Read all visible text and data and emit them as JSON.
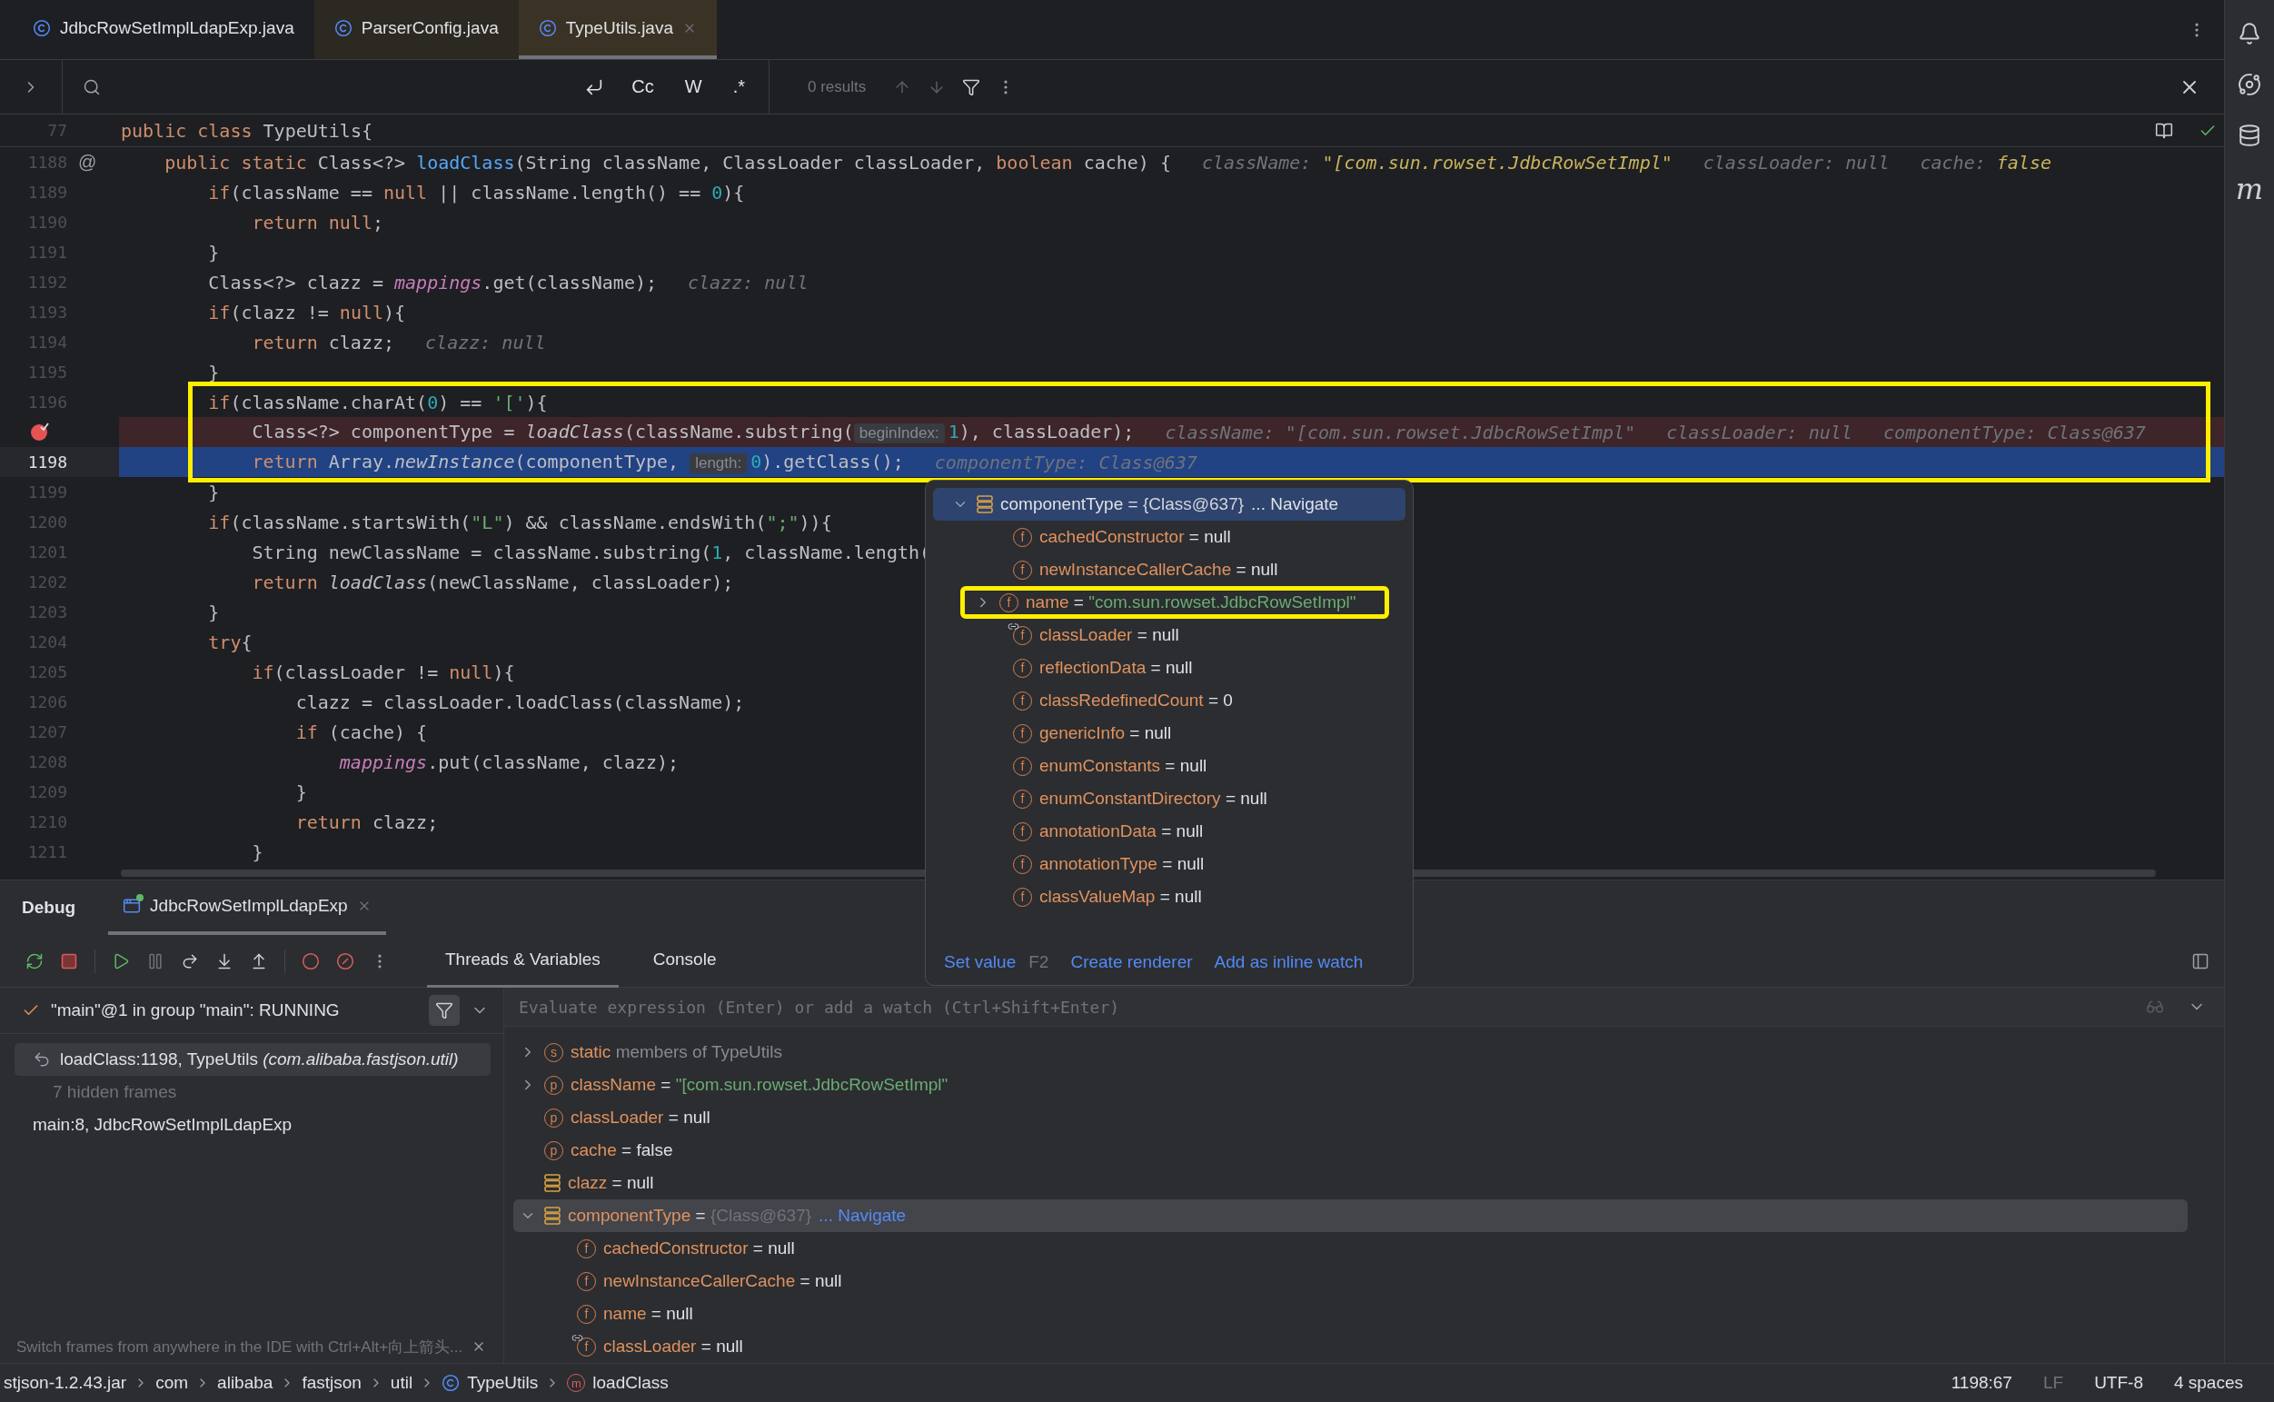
{
  "editor_tabs": [
    {
      "label": "JdbcRowSetImplLdapExp.java",
      "library": false,
      "selected": false
    },
    {
      "label": "ParserConfig.java",
      "library": true,
      "selected": false
    },
    {
      "label": "TypeUtils.java",
      "library": true,
      "selected": true
    }
  ],
  "find_bar": {
    "options": [
      "Cc",
      "W",
      ".*"
    ],
    "results": "0 results"
  },
  "sticky_line": {
    "number": "77",
    "tokens": [
      {
        "kind": "keyword",
        "text": "public class "
      },
      {
        "kind": "plain",
        "text": "TypeUtils{"
      }
    ]
  },
  "code_lines": [
    {
      "number": "1188",
      "gutter_mark": "@",
      "kind": "normal",
      "tokens": [
        {
          "kind": "keyword",
          "text": "    public static "
        },
        {
          "kind": "plain",
          "text": "Class<?> "
        },
        {
          "kind": "declaration",
          "text": "loadClass"
        },
        {
          "kind": "plain",
          "text": "(String className, ClassLoader classLoader, "
        },
        {
          "kind": "keyword",
          "text": "boolean"
        },
        {
          "kind": "plain",
          "text": " cache) {"
        }
      ],
      "inline_values": [
        {
          "name": "className:",
          "value": "\"[com.sun.rowset.JdbcRowSetImpl\"",
          "kind": "string"
        },
        {
          "name": "classLoader:",
          "value": "null",
          "kind": "plain"
        },
        {
          "name": "cache:",
          "value": "false",
          "kind": "string"
        }
      ]
    },
    {
      "number": "1189",
      "kind": "normal",
      "tokens": [
        {
          "kind": "keyword",
          "text": "        if"
        },
        {
          "kind": "plain",
          "text": "(className == "
        },
        {
          "kind": "keyword",
          "text": "null"
        },
        {
          "kind": "plain",
          "text": " || className.length() == "
        },
        {
          "kind": "number",
          "text": "0"
        },
        {
          "kind": "plain",
          "text": "){"
        }
      ]
    },
    {
      "number": "1190",
      "kind": "normal",
      "tokens": [
        {
          "kind": "keyword",
          "text": "            return null"
        },
        {
          "kind": "plain",
          "text": ";"
        }
      ]
    },
    {
      "number": "1191",
      "kind": "normal",
      "tokens": [
        {
          "kind": "plain",
          "text": "        }"
        }
      ]
    },
    {
      "number": "1192",
      "kind": "normal",
      "tokens": [
        {
          "kind": "plain",
          "text": "        Class<?> clazz = "
        },
        {
          "kind": "field",
          "text": "mappings"
        },
        {
          "kind": "plain",
          "text": ".get(className);"
        }
      ],
      "inline_values": [
        {
          "name": "clazz:",
          "value": "null",
          "kind": "plain"
        }
      ]
    },
    {
      "number": "1193",
      "kind": "normal",
      "tokens": [
        {
          "kind": "keyword",
          "text": "        if"
        },
        {
          "kind": "plain",
          "text": "(clazz != "
        },
        {
          "kind": "keyword",
          "text": "null"
        },
        {
          "kind": "plain",
          "text": "){"
        }
      ]
    },
    {
      "number": "1194",
      "kind": "normal",
      "tokens": [
        {
          "kind": "keyword",
          "text": "            return"
        },
        {
          "kind": "plain",
          "text": " clazz;"
        }
      ],
      "inline_values": [
        {
          "name": "clazz:",
          "value": "null",
          "kind": "plain"
        }
      ]
    },
    {
      "number": "1195",
      "kind": "normal",
      "tokens": [
        {
          "kind": "plain",
          "text": "        }"
        }
      ]
    },
    {
      "number": "1196",
      "kind": "normal",
      "tokens": [
        {
          "kind": "keyword",
          "text": "        if"
        },
        {
          "kind": "plain",
          "text": "(className.charAt("
        },
        {
          "kind": "number",
          "text": "0"
        },
        {
          "kind": "plain",
          "text": ") == "
        },
        {
          "kind": "string",
          "text": "'['"
        },
        {
          "kind": "plain",
          "text": "){"
        }
      ]
    },
    {
      "kind": "breakpoint",
      "tokens": [
        {
          "kind": "plain",
          "text": "            Class<?> componentType = "
        },
        {
          "kind": "call",
          "text": "loadClass"
        },
        {
          "kind": "plain",
          "text": "(className.substring("
        },
        {
          "kind": "hint",
          "text": "beginIndex:"
        },
        {
          "kind": "number",
          "text": "1"
        },
        {
          "kind": "plain",
          "text": "), classLoader);"
        }
      ],
      "inline_values": [
        {
          "name": "className:",
          "value": "\"[com.sun.rowset.JdbcRowSetImpl\"",
          "kind": "plain"
        },
        {
          "name": "classLoader:",
          "value": "null",
          "kind": "plain"
        },
        {
          "name": "componentType:",
          "value": "Class@637",
          "kind": "plain"
        }
      ]
    },
    {
      "number": "1198",
      "kind": "current",
      "tokens": [
        {
          "kind": "keyword",
          "text": "            return"
        },
        {
          "kind": "plain",
          "text": " Array."
        },
        {
          "kind": "call",
          "text": "newInstance"
        },
        {
          "kind": "plain",
          "text": "(componentType, "
        },
        {
          "kind": "hint",
          "text": "length:"
        },
        {
          "kind": "number",
          "text": "0"
        },
        {
          "kind": "plain",
          "text": ").getClass();"
        }
      ],
      "inline_values": [
        {
          "name": "componentType:",
          "value": "Class@637",
          "kind": "plain"
        }
      ]
    },
    {
      "number": "1199",
      "kind": "normal",
      "tokens": [
        {
          "kind": "plain",
          "text": "        }"
        }
      ]
    },
    {
      "number": "1200",
      "kind": "normal",
      "tokens": [
        {
          "kind": "keyword",
          "text": "        if"
        },
        {
          "kind": "plain",
          "text": "(className.startsWith("
        },
        {
          "kind": "string",
          "text": "\"L\""
        },
        {
          "kind": "plain",
          "text": ") && className.endsWith("
        },
        {
          "kind": "string",
          "text": "\";\""
        },
        {
          "kind": "plain",
          "text": ")){"
        }
      ]
    },
    {
      "number": "1201",
      "kind": "normal",
      "tokens": [
        {
          "kind": "plain",
          "text": "            String newClassName = className.substring("
        },
        {
          "kind": "number",
          "text": "1"
        },
        {
          "kind": "plain",
          "text": ", className.length("
        }
      ]
    },
    {
      "number": "1202",
      "kind": "normal",
      "tokens": [
        {
          "kind": "keyword",
          "text": "            return "
        },
        {
          "kind": "call",
          "text": "loadClass"
        },
        {
          "kind": "plain",
          "text": "(newClassName, classLoader);"
        }
      ]
    },
    {
      "number": "1203",
      "kind": "normal",
      "tokens": [
        {
          "kind": "plain",
          "text": "        }"
        }
      ]
    },
    {
      "number": "1204",
      "kind": "normal",
      "tokens": [
        {
          "kind": "keyword",
          "text": "        try"
        },
        {
          "kind": "plain",
          "text": "{"
        }
      ]
    },
    {
      "number": "1205",
      "kind": "normal",
      "tokens": [
        {
          "kind": "keyword",
          "text": "            if"
        },
        {
          "kind": "plain",
          "text": "(classLoader != "
        },
        {
          "kind": "keyword",
          "text": "null"
        },
        {
          "kind": "plain",
          "text": "){"
        }
      ]
    },
    {
      "number": "1206",
      "kind": "normal",
      "tokens": [
        {
          "kind": "plain",
          "text": "                clazz = classLoader.loadClass(className);"
        }
      ]
    },
    {
      "number": "1207",
      "kind": "normal",
      "tokens": [
        {
          "kind": "keyword",
          "text": "                if"
        },
        {
          "kind": "plain",
          "text": " (cache) {"
        }
      ]
    },
    {
      "number": "1208",
      "kind": "normal",
      "tokens": [
        {
          "kind": "field",
          "text": "                    mappings"
        },
        {
          "kind": "plain",
          "text": ".put(className, clazz);"
        }
      ]
    },
    {
      "number": "1209",
      "kind": "normal",
      "tokens": [
        {
          "kind": "plain",
          "text": "                }"
        }
      ]
    },
    {
      "number": "1210",
      "kind": "normal",
      "tokens": [
        {
          "kind": "keyword",
          "text": "                return"
        },
        {
          "kind": "plain",
          "text": " clazz;"
        }
      ]
    },
    {
      "number": "1211",
      "kind": "normal",
      "tokens": [
        {
          "kind": "plain",
          "text": "            }"
        }
      ]
    }
  ],
  "value_popup": {
    "root": {
      "kind": "local",
      "name": "componentType",
      "op": "=",
      "value": {
        "kind": "ref",
        "text": "{Class@637}"
      },
      "link": "... Navigate",
      "expanded": true,
      "selected": true,
      "highlighted": false,
      "overlay": false
    },
    "fields": [
      {
        "kind": "member",
        "badge": "f",
        "name": "cachedConstructor",
        "op": "=",
        "value": {
          "kind": "plain",
          "text": "null"
        },
        "selected": false,
        "highlighted": false,
        "overlay": false
      },
      {
        "kind": "member",
        "badge": "f",
        "name": "newInstanceCallerCache",
        "op": "=",
        "value": {
          "kind": "plain",
          "text": "null"
        },
        "selected": false,
        "highlighted": false,
        "overlay": false
      },
      {
        "kind": "member",
        "badge": "f",
        "name": "name",
        "op": "=",
        "value": {
          "kind": "string",
          "text": "\"com.sun.rowset.JdbcRowSetImpl\""
        },
        "expanded": false,
        "selected": false,
        "highlighted": true,
        "overlay": false
      },
      {
        "kind": "member",
        "badge": "f",
        "name": "classLoader",
        "op": "=",
        "value": {
          "kind": "plain",
          "text": "null"
        },
        "selected": false,
        "highlighted": false,
        "overlay": true
      },
      {
        "kind": "member",
        "badge": "f",
        "name": "reflectionData",
        "op": "=",
        "value": {
          "kind": "plain",
          "text": "null"
        },
        "selected": false,
        "highlighted": false,
        "overlay": false
      },
      {
        "kind": "member",
        "badge": "f",
        "name": "classRedefinedCount",
        "op": "=",
        "value": {
          "kind": "plain",
          "text": "0"
        },
        "selected": false,
        "highlighted": false,
        "overlay": false
      },
      {
        "kind": "member",
        "badge": "f",
        "name": "genericInfo",
        "op": "=",
        "value": {
          "kind": "plain",
          "text": "null"
        },
        "selected": false,
        "highlighted": false,
        "overlay": false
      },
      {
        "kind": "member",
        "badge": "f",
        "name": "enumConstants",
        "op": "=",
        "value": {
          "kind": "plain",
          "text": "null"
        },
        "selected": false,
        "highlighted": false,
        "overlay": false
      },
      {
        "kind": "member",
        "badge": "f",
        "name": "enumConstantDirectory",
        "op": "=",
        "value": {
          "kind": "plain",
          "text": "null"
        },
        "selected": false,
        "highlighted": false,
        "overlay": false
      },
      {
        "kind": "member",
        "badge": "f",
        "name": "annotationData",
        "op": "=",
        "value": {
          "kind": "plain",
          "text": "null"
        },
        "selected": false,
        "highlighted": false,
        "overlay": false
      },
      {
        "kind": "member",
        "badge": "f",
        "name": "annotationType",
        "op": "=",
        "value": {
          "kind": "plain",
          "text": "null"
        },
        "selected": false,
        "highlighted": false,
        "overlay": false
      },
      {
        "kind": "member",
        "badge": "f",
        "name": "classValueMap",
        "op": "=",
        "value": {
          "kind": "plain",
          "text": "null"
        },
        "selected": false,
        "highlighted": false,
        "overlay": false
      }
    ],
    "actions": [
      {
        "label": "Set value",
        "shortcut": "F2"
      },
      {
        "label": "Create renderer"
      },
      {
        "label": "Add as inline watch"
      }
    ]
  },
  "debug_panel": {
    "title": "Debug",
    "session_tab": {
      "label": "JdbcRowSetImplLdapExp",
      "running": true
    },
    "view_tabs": [
      {
        "label": "Threads & Variables",
        "selected": true
      },
      {
        "label": "Console",
        "selected": false
      }
    ],
    "thread": {
      "label": "\"main\"@1 in group \"main\": RUNNING"
    },
    "frames": [
      {
        "kind": "frame",
        "text": "loadClass:1198, TypeUtils *(com.alibaba.fastjson.util)*",
        "selected": true
      },
      {
        "kind": "hidden",
        "text": "7 hidden frames",
        "selected": false
      },
      {
        "kind": "frame",
        "text": "main:8, JdbcRowSetImplLdapExp",
        "selected": false
      }
    ],
    "frames_hint": "Switch frames from anywhere in the IDE with Ctrl+Alt+向上箭头...",
    "evaluate": {
      "placeholder": "Evaluate expression (Enter) or add a watch (Ctrl+Shift+Enter)"
    },
    "variables": [
      {
        "kind": "member",
        "badge": "s",
        "name": "static",
        "value": {
          "kind": "note",
          "text": "members of TypeUtils"
        },
        "expanded": false,
        "selected": false,
        "overlay": false
      },
      {
        "kind": "member",
        "badge": "p",
        "name": "className",
        "op": "=",
        "value": {
          "kind": "string",
          "text": "\"[com.sun.rowset.JdbcRowSetImpl\""
        },
        "expanded": false,
        "selected": false,
        "overlay": false
      },
      {
        "kind": "member",
        "badge": "p",
        "name": "classLoader",
        "op": "=",
        "value": {
          "kind": "plain",
          "text": "null"
        },
        "selected": false,
        "overlay": false
      },
      {
        "kind": "member",
        "badge": "p",
        "name": "cache",
        "op": "=",
        "value": {
          "kind": "plain",
          "text": "false"
        },
        "selected": false,
        "overlay": false
      },
      {
        "kind": "local",
        "name": "clazz",
        "op": "=",
        "value": {
          "kind": "plain",
          "text": "null"
        },
        "selected": false,
        "overlay": false
      },
      {
        "kind": "local",
        "name": "componentType",
        "op": "=",
        "value": {
          "kind": "ref",
          "text": "{Class@637}"
        },
        "link": "... Navigate",
        "expanded": true,
        "selected": true,
        "overlay": false,
        "children": [
          {
            "kind": "member",
            "badge": "f",
            "name": "cachedConstructor",
            "op": "=",
            "value": {
              "kind": "plain",
              "text": "null"
            },
            "selected": false,
            "overlay": false
          },
          {
            "kind": "member",
            "badge": "f",
            "name": "newInstanceCallerCache",
            "op": "=",
            "value": {
              "kind": "plain",
              "text": "null"
            },
            "selected": false,
            "overlay": false
          },
          {
            "kind": "member",
            "badge": "f",
            "name": "name",
            "op": "=",
            "value": {
              "kind": "plain",
              "text": "null"
            },
            "selected": false,
            "overlay": false
          },
          {
            "kind": "member",
            "badge": "f",
            "name": "classLoader",
            "op": "=",
            "value": {
              "kind": "plain",
              "text": "null"
            },
            "selected": false,
            "overlay": true
          }
        ]
      }
    ]
  },
  "status_bar": {
    "breadcrumbs": [
      {
        "kind": "text",
        "label": "stjson-1.2.43.jar"
      },
      {
        "kind": "text",
        "label": "com"
      },
      {
        "kind": "text",
        "label": "alibaba"
      },
      {
        "kind": "text",
        "label": "fastjson"
      },
      {
        "kind": "text",
        "label": "util"
      },
      {
        "kind": "class",
        "label": "TypeUtils"
      },
      {
        "kind": "method",
        "badge": "m",
        "label": "loadClass"
      }
    ],
    "items": [
      "1198:67",
      "LF",
      "UTF-8",
      "4 spaces"
    ]
  },
  "tool_strip": [
    {
      "kind": "notifications"
    },
    {
      "kind": "assistant"
    },
    {
      "kind": "database"
    },
    {
      "kind": "letter",
      "label": "m"
    }
  ]
}
